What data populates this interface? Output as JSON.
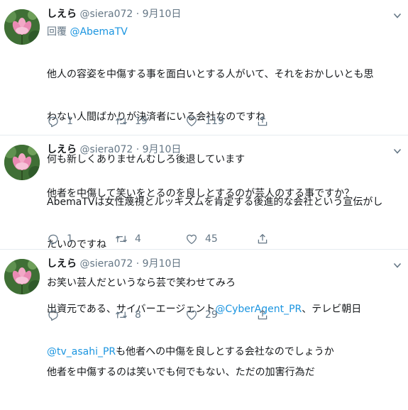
{
  "tweets": [
    {
      "name": "しえら",
      "handle": "@siera072",
      "date": "· 9月10日",
      "reply_prefix": "回覆",
      "reply_to": "@AbemaTV",
      "lines": [
        "他人の容姿を中傷する事を面白いとする人がいて、それをおかしいとも思",
        "わない人間ばかりが決済者にいる会社なのですね",
        "何も新しくありませんむしろ後退しています",
        "AbemaTVは女性蔑視とルッキズムを肯定する後進的な会社という宣伝がし",
        "たいのですね"
      ],
      "replies": "1",
      "retweets": "19",
      "likes": "119"
    },
    {
      "name": "しえら",
      "handle": "@siera072",
      "date": "· 9月10日",
      "lines": [
        "他者を中傷して笑いをとるのを良しとするのが芸人のする事ですか？",
        "",
        "お笑い芸人だというなら芸で笑わせてみろ",
        "",
        "他者を中傷するのは笑いでも何でもない、ただの加害行為だ"
      ],
      "replies": "1",
      "retweets": "4",
      "likes": "45"
    },
    {
      "name": "しえら",
      "handle": "@siera072",
      "date": "· 9月10日",
      "line1_prefix": "出資元である、サイバーエージェント",
      "line1_link": "@CyberAgent_PR",
      "line1_suffix": "、テレビ朝日",
      "line2_link": "@tv_asahi_PR",
      "line2_suffix": "も他者への中傷を良しとする会社なのでしょうか",
      "replies": "",
      "retweets": "8",
      "likes": "29"
    }
  ],
  "icons": [
    "reply-icon",
    "retweet-icon",
    "like-icon",
    "share-icon",
    "caret-down-icon"
  ],
  "colors": {
    "link": "#1b95e0",
    "meta": "#657786",
    "text": "#14171a"
  }
}
